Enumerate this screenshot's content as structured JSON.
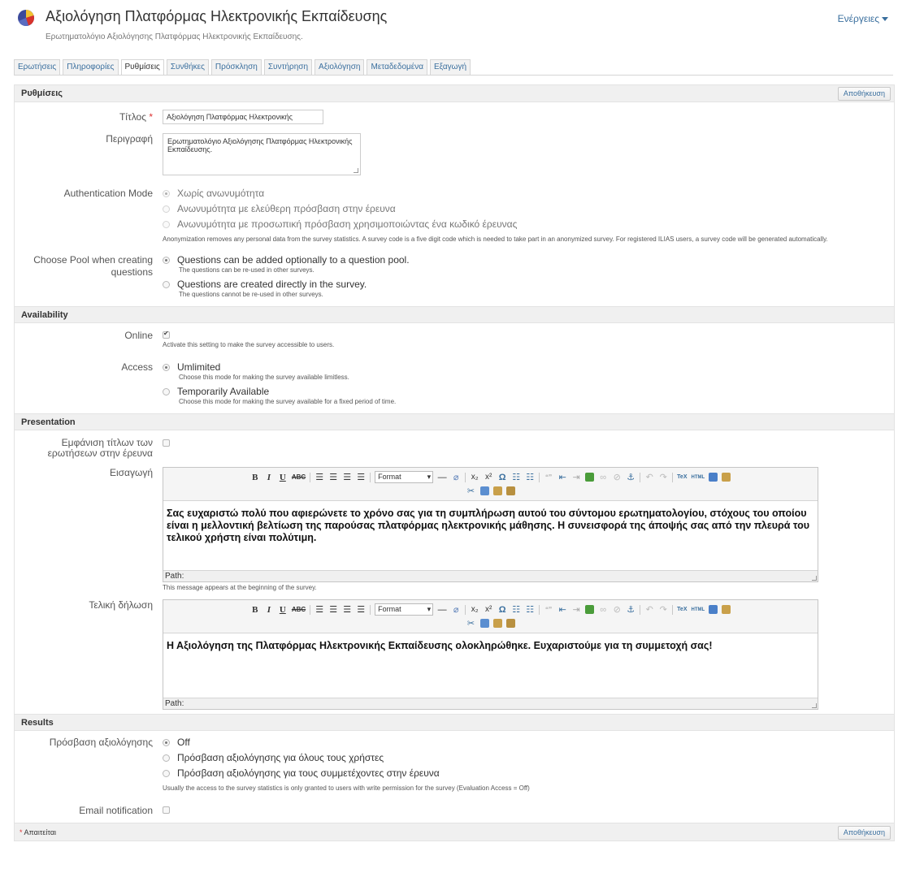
{
  "header": {
    "title": "Αξιολόγηση Πλατφόρμας Ηλεκτρονικής Εκπαίδευσης",
    "description": "Ερωτηματολόγιο Αξιολόγησης Πλατφόρμας Ηλεκτρονικής Εκπαίδευσης.",
    "actions_label": "Ενέργειες"
  },
  "tabs": [
    {
      "label": "Ερωτήσεις"
    },
    {
      "label": "Πληροφορίες"
    },
    {
      "label": "Ρυθμίσεις",
      "active": true
    },
    {
      "label": "Συνθήκες"
    },
    {
      "label": "Πρόσκληση"
    },
    {
      "label": "Συντήρηση"
    },
    {
      "label": "Αξιολόγηση"
    },
    {
      "label": "Μεταδεδομένα"
    },
    {
      "label": "Εξαγωγή"
    }
  ],
  "settings": {
    "section_title": "Ρυθμίσεις",
    "save_label": "Αποθήκευση",
    "title_label": "Τίτλος",
    "required_mark": "*",
    "title_value": "Αξιολόγηση Πλατφόρμας Ηλεκτρονικής",
    "description_label": "Περιγραφή",
    "description_value": "Ερωτηματολόγιο Αξιολόγησης Πλατφόρμας Ηλεκτρονικής Εκπαίδευσης.",
    "auth_label": "Authentication Mode",
    "auth_options": [
      {
        "label": "Χωρίς ανωνυμότητα",
        "selected": true
      },
      {
        "label": "Ανωνυμότητα με ελεύθερη πρόσβαση στην έρευνα",
        "selected": false
      },
      {
        "label": "Ανωνυμότητα με προσωπική πρόσβαση χρησιμοποιώντας ένα κωδικό έρευνας",
        "selected": false
      }
    ],
    "auth_info": "Anonymization removes any personal data from the survey statistics. A survey code is a five digit code which is needed to take part in an anonymized survey. For registered ILIAS users, a survey code will be generated automatically.",
    "pool_label_line1": "Choose Pool when creating",
    "pool_label_line2": "questions",
    "pool_options": [
      {
        "label": "Questions can be added optionally to a question pool.",
        "info": "The questions can be re-used in other surveys.",
        "selected": true
      },
      {
        "label": "Questions are created directly in the survey.",
        "info": "The questions cannot be re-used in other surveys.",
        "selected": false
      }
    ]
  },
  "availability": {
    "section_title": "Availability",
    "online_label": "Online",
    "online_checked": true,
    "online_info": "Activate this setting to make the survey accessible to users.",
    "access_label": "Access",
    "access_options": [
      {
        "label": "Umlimited",
        "info": "Choose this mode for making the survey available limitless.",
        "selected": true
      },
      {
        "label": "Temporarily Available",
        "info": "Choose this mode for making the survey available for a fixed period of time.",
        "selected": false
      }
    ]
  },
  "presentation": {
    "section_title": "Presentation",
    "show_titles_label_line1": "Εμφάνιση τίτλων των",
    "show_titles_label_line2": "ερωτήσεων στην έρευνα",
    "show_titles_checked": false,
    "intro_label": "Εισαγωγή",
    "intro_text": "Σας ευχαριστώ πολύ που αφιερώνετε το χρόνο σας για τη συμπλήρωση αυτού του σύντομου ερωτηματολογίου, στόχους του οποίου είναι η μελλοντική βελτίωση της παρούσας πλατφόρμας ηλεκτρονικής μάθησης. Η συνεισφορά της άποψής σας από την πλευρά του τελικού χρήστη είναι πολύτιμη.",
    "intro_info": "This message appears at the beginning of the survey.",
    "final_label": "Τελική δήλωση",
    "final_text": "Η Αξιολόγηση της Πλατφόρμας Ηλεκτρονικής Εκπαίδευσης ολοκληρώθηκε. Ευχαριστούμε για τη συμμετοχή σας!",
    "path_label": "Path:",
    "format_label": "Format"
  },
  "results": {
    "section_title": "Results",
    "eval_label": "Πρόσβαση αξιολόγησης",
    "eval_options": [
      {
        "label": "Off",
        "selected": true
      },
      {
        "label": "Πρόσβαση αξιολόγησης για όλους τους χρήστες",
        "selected": false
      },
      {
        "label": "Πρόσβαση αξιολόγησης για τους συμμετέχοντες στην έρευνα",
        "selected": false
      }
    ],
    "eval_info": "Usually the access to the survey statistics is only granted to users with write permission for the survey (Evaluation Access = Off)",
    "email_label": "Email notification",
    "email_checked": false
  },
  "footer": {
    "required_mark": "*",
    "required_text": "Απαιτείται",
    "save_label": "Αποθήκευση"
  },
  "toolbar_icons": [
    "bold-icon",
    "italic-icon",
    "underline-icon",
    "strikethrough-icon",
    "align-left-icon",
    "align-center-icon",
    "align-right-icon",
    "align-justify-icon",
    "format-select",
    "horizontal-rule-icon",
    "remove-format-icon",
    "subscript-icon",
    "superscript-icon",
    "omega-icon",
    "bullet-list-icon",
    "numbered-list-icon",
    "quote-icon",
    "outdent-icon",
    "indent-icon",
    "image-icon",
    "link-icon",
    "unlink-icon",
    "anchor-icon",
    "undo-icon",
    "redo-icon",
    "tex-icon",
    "html-icon",
    "fullscreen-icon",
    "paste-icon",
    "cut-icon",
    "copy-icon",
    "paste-text-icon",
    "paste-word-icon"
  ]
}
